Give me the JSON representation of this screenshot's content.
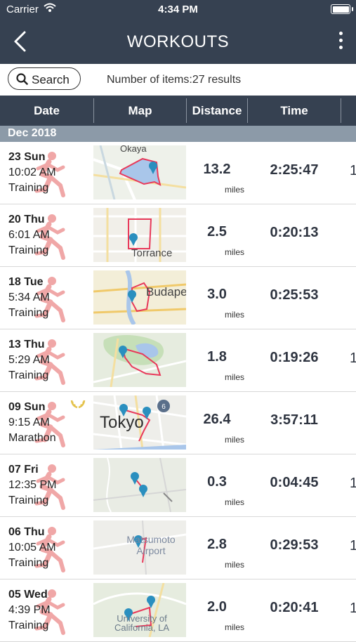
{
  "status_bar": {
    "carrier": "Carrier",
    "time": "4:34 PM"
  },
  "nav": {
    "title": "WORKOUTS"
  },
  "search": {
    "label": "Search",
    "count_text": "Number of items:27 results"
  },
  "columns": {
    "date": "Date",
    "map": "Map",
    "distance": "Distance",
    "time": "Time"
  },
  "section": {
    "title": "Dec 2018"
  },
  "workouts": [
    {
      "day": "23 Sun",
      "time": "10:02 AM",
      "type": "Training",
      "distance": "13.2",
      "unit": "miles",
      "duration": "2:25:47",
      "map_label": "Okaya",
      "edge": "1"
    },
    {
      "day": "20 Thu",
      "time": "6:01 AM",
      "type": "Training",
      "distance": "2.5",
      "unit": "miles",
      "duration": "0:20:13",
      "map_label": "Torrance",
      "edge": ""
    },
    {
      "day": "18 Tue",
      "time": "5:34 AM",
      "type": "Training",
      "distance": "3.0",
      "unit": "miles",
      "duration": "0:25:53",
      "map_label": "Budape",
      "edge": ""
    },
    {
      "day": "13 Thu",
      "time": "5:29 AM",
      "type": "Training",
      "distance": "1.8",
      "unit": "miles",
      "duration": "0:19:26",
      "map_label": "",
      "edge": "1"
    },
    {
      "day": "09 Sun",
      "time": "9:15 AM",
      "type": "Marathon",
      "distance": "26.4",
      "unit": "miles",
      "duration": "3:57:11",
      "map_label": "Tokyo",
      "edge": ""
    },
    {
      "day": "07 Fri",
      "time": "12:35 PM",
      "type": "Training",
      "distance": "0.3",
      "unit": "miles",
      "duration": "0:04:45",
      "map_label": "",
      "edge": "1"
    },
    {
      "day": "06 Thu",
      "time": "10:05 AM",
      "type": "Training",
      "distance": "2.8",
      "unit": "miles",
      "duration": "0:29:53",
      "map_label": "Matsumoto Airport",
      "edge": "1"
    },
    {
      "day": "05 Wed",
      "time": "4:39 PM",
      "type": "Training",
      "distance": "2.0",
      "unit": "miles",
      "duration": "0:20:41",
      "map_label": "University of California, LA",
      "edge": "1"
    }
  ],
  "colors": {
    "nav_bg": "#364151",
    "section_bg": "#8c9aa8",
    "runner": "#f0a7a7",
    "route": "#e8395a",
    "pin": "#2a8fbf"
  }
}
